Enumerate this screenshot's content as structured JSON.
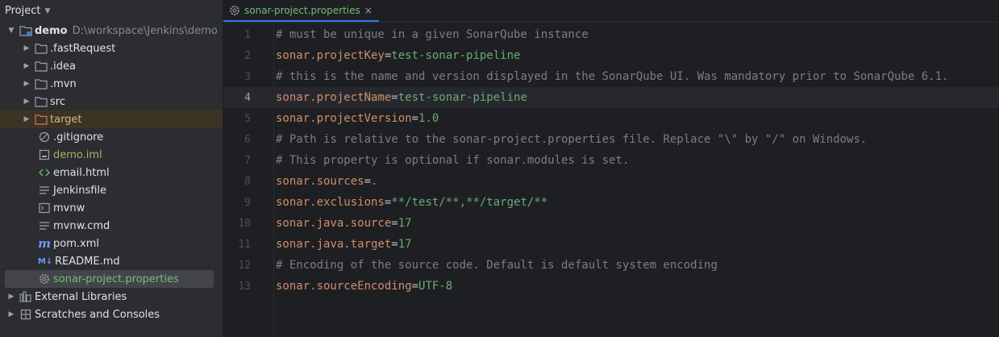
{
  "project_panel": {
    "title": "Project",
    "tree": [
      {
        "id": "demo",
        "label": "demo",
        "path": "D:\\workspace\\Jenkins\\demo"
      },
      {
        "id": "fastrequest",
        "label": ".fastRequest"
      },
      {
        "id": "idea",
        "label": ".idea"
      },
      {
        "id": "mvn",
        "label": ".mvn"
      },
      {
        "id": "src",
        "label": "src"
      },
      {
        "id": "target",
        "label": "target"
      },
      {
        "id": "gitignore",
        "label": ".gitignore"
      },
      {
        "id": "demo-iml",
        "label": "demo.iml"
      },
      {
        "id": "email-html",
        "label": "email.html"
      },
      {
        "id": "jenkinsfile",
        "label": "Jenkinsfile"
      },
      {
        "id": "mvnw",
        "label": "mvnw"
      },
      {
        "id": "mvnw-cmd",
        "label": "mvnw.cmd"
      },
      {
        "id": "pom-xml",
        "label": "pom.xml"
      },
      {
        "id": "readme",
        "label": "README.md"
      },
      {
        "id": "sonar-props",
        "label": "sonar-project.properties"
      },
      {
        "id": "external-libraries",
        "label": "External Libraries"
      },
      {
        "id": "scratches",
        "label": "Scratches and Consoles"
      }
    ]
  },
  "editor": {
    "tab": {
      "label": "sonar-project.properties",
      "close": "×"
    },
    "current_line": 4,
    "lines": [
      {
        "n": "1",
        "comment": "# must be unique in a given SonarQube instance"
      },
      {
        "n": "2",
        "key": "sonar.projectKey",
        "eq": "=",
        "val": "test-sonar-pipeline"
      },
      {
        "n": "3",
        "comment": "# this is the name and version displayed in the SonarQube UI. Was mandatory prior to SonarQube 6.1."
      },
      {
        "n": "4",
        "key": "sonar.projectName",
        "eq": "=",
        "val": "test-sonar-pipeline"
      },
      {
        "n": "5",
        "key": "sonar.projectVersion",
        "eq": "=",
        "val": "1.0"
      },
      {
        "n": "6",
        "comment": "# Path is relative to the sonar-project.properties file. Replace \"\\\" by \"/\" on Windows."
      },
      {
        "n": "7",
        "comment": "# This property is optional if sonar.modules is set."
      },
      {
        "n": "8",
        "key": "sonar.sources",
        "eq": "=",
        "val": "."
      },
      {
        "n": "9",
        "key": "sonar.exclusions",
        "eq": "=",
        "val": "**/test/**,**/target/**"
      },
      {
        "n": "10",
        "key": "sonar.java.source",
        "eq": "=",
        "val": "17"
      },
      {
        "n": "11",
        "key": "sonar.java.target",
        "eq": "=",
        "val": "17"
      },
      {
        "n": "12",
        "comment": "# Encoding of the source code. Default is default system encoding"
      },
      {
        "n": "13",
        "key": "sonar.sourceEncoding",
        "eq": "=",
        "val": "UTF-8"
      }
    ]
  }
}
